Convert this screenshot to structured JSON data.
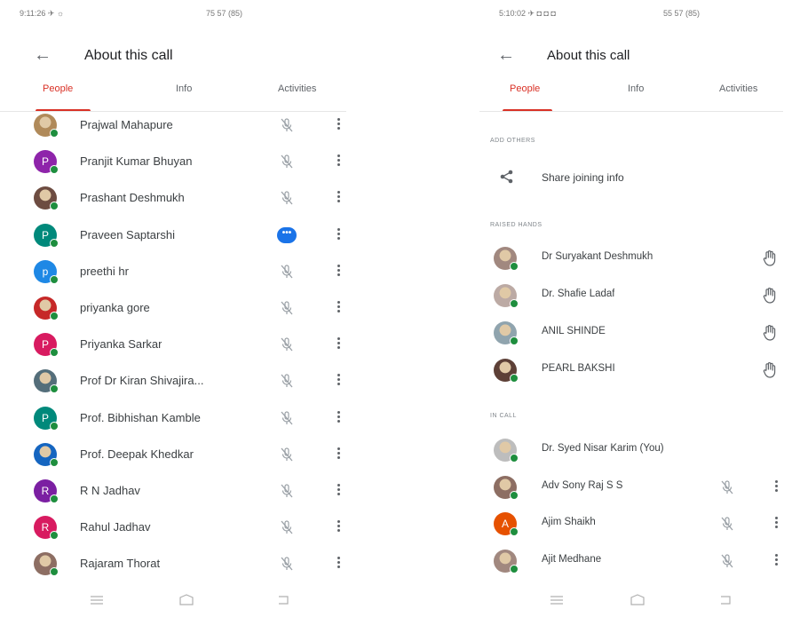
{
  "left": {
    "status": {
      "left": "9:11:26 ✈ ☼",
      "right": "75 57 (85)"
    },
    "title": "About this call",
    "tabs": [
      "People",
      "Info",
      "Activities"
    ],
    "people": [
      {
        "name": "Prajwal Mahapure",
        "initial": "",
        "color": "#b08a5a",
        "photo": true,
        "action": "mic-off"
      },
      {
        "name": "Pranjit Kumar Bhuyan",
        "initial": "P",
        "color": "#8e24aa",
        "photo": false,
        "action": "mic-off"
      },
      {
        "name": "Prashant Deshmukh",
        "initial": "",
        "color": "#6d4c41",
        "photo": true,
        "action": "mic-off"
      },
      {
        "name": "Praveen Saptarshi",
        "initial": "P",
        "color": "#00897b",
        "photo": false,
        "action": "speaking"
      },
      {
        "name": "preethi hr",
        "initial": "p",
        "color": "#1e88e5",
        "photo": false,
        "action": "mic-off"
      },
      {
        "name": "priyanka gore",
        "initial": "",
        "color": "#c62828",
        "photo": true,
        "action": "mic-off"
      },
      {
        "name": "Priyanka Sarkar",
        "initial": "P",
        "color": "#d81b60",
        "photo": false,
        "action": "mic-off"
      },
      {
        "name": "Prof Dr Kiran Shivajira...",
        "initial": "",
        "color": "#546e7a",
        "photo": true,
        "action": "mic-off"
      },
      {
        "name": "Prof. Bibhishan Kamble",
        "initial": "P",
        "color": "#00897b",
        "photo": false,
        "action": "mic-off"
      },
      {
        "name": "Prof. Deepak Khedkar",
        "initial": "",
        "color": "#1565c0",
        "photo": true,
        "action": "mic-off"
      },
      {
        "name": "R N Jadhav",
        "initial": "R",
        "color": "#7b1fa2",
        "photo": false,
        "action": "mic-off"
      },
      {
        "name": "Rahul Jadhav",
        "initial": "R",
        "color": "#d81b60",
        "photo": false,
        "action": "mic-off"
      },
      {
        "name": "Rajaram Thorat",
        "initial": "",
        "color": "#8d6e63",
        "photo": true,
        "action": "mic-off"
      }
    ]
  },
  "right": {
    "status": {
      "left": "5:10:02 ✈ ◘ ◘ ◘",
      "right": "55 57 (85)"
    },
    "title": "About this call",
    "tabs": [
      "People",
      "Info",
      "Activities"
    ],
    "add_others_label": "ADD OTHERS",
    "share_label": "Share joining info",
    "raised_label": "RAISED HANDS",
    "raised": [
      {
        "name": "Dr Suryakant Deshmukh",
        "color": "#a1887f"
      },
      {
        "name": "Dr. Shafie Ladaf",
        "color": "#bcaaa4"
      },
      {
        "name": "ANIL SHINDE",
        "color": "#90a4ae"
      },
      {
        "name": "PEARL BAKSHI",
        "color": "#5d4037"
      }
    ],
    "incall_label": "IN CALL",
    "incall": [
      {
        "name": "Dr. Syed Nisar Karim (You)",
        "initial": "",
        "color": "#bdbdbd",
        "photo": true,
        "action": "none"
      },
      {
        "name": "Adv Sony Raj S S",
        "initial": "",
        "color": "#8d6e63",
        "photo": true,
        "action": "mic-off"
      },
      {
        "name": "Ajim Shaikh",
        "initial": "A",
        "color": "#e65100",
        "photo": false,
        "action": "mic-off"
      },
      {
        "name": "Ajit Medhane",
        "initial": "",
        "color": "#a1887f",
        "photo": true,
        "action": "mic-off"
      }
    ]
  },
  "colors": {
    "accent": "#d93025",
    "online": "#1e8e3e",
    "speaking": "#1a73e8"
  }
}
